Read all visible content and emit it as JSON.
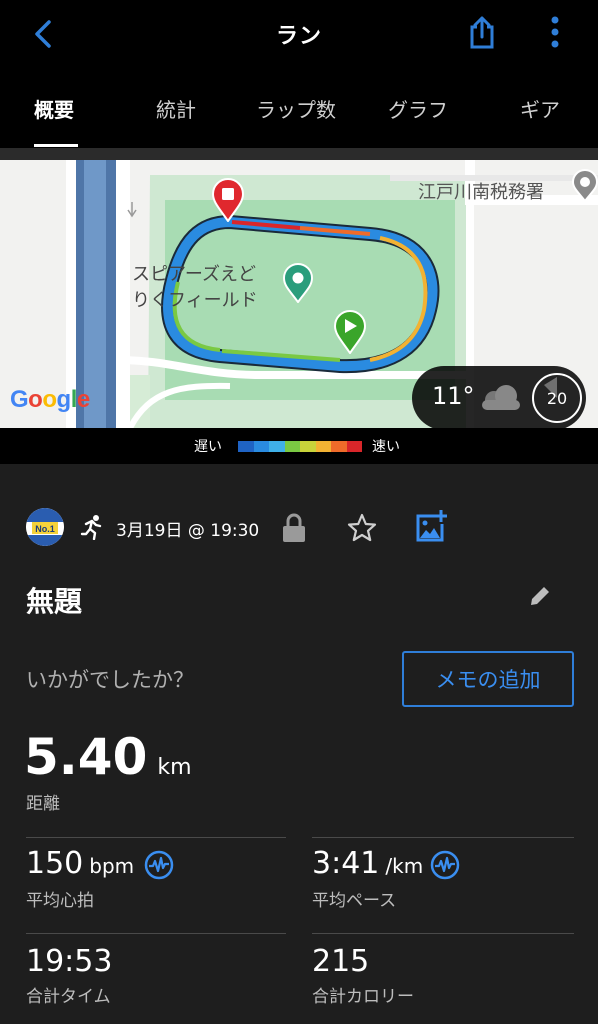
{
  "header": {
    "title": "ラン",
    "back_icon": "chevron-left-icon",
    "share_icon": "share-icon",
    "more_icon": "more-vertical-icon",
    "accent_color": "#2f7ed8"
  },
  "tabs": [
    {
      "label": "概要",
      "active": true
    },
    {
      "label": "統計",
      "active": false
    },
    {
      "label": "ラップ数",
      "active": false
    },
    {
      "label": "グラフ",
      "active": false
    },
    {
      "label": "ギア",
      "active": false
    }
  ],
  "map": {
    "labels": {
      "place_line1": "スピアーズえど",
      "place_line2": "りくフィールド",
      "tax_office": "江戸川南税務署"
    },
    "google_logo": "Google",
    "weather": {
      "temp": "11°",
      "icon": "cloud-icon",
      "wind": "20"
    }
  },
  "legend": {
    "slow": "遅い",
    "fast": "速い",
    "colors": [
      "#1f63c4",
      "#2a8be0",
      "#3fb0e8",
      "#7ac943",
      "#c8d33a",
      "#f2b233",
      "#ef6b2a",
      "#d9262a"
    ]
  },
  "activity": {
    "date": "3月19日 @ 19:30",
    "name": "無題",
    "question": "いかがでしたか？",
    "memo_button": "メモの追加",
    "distance": {
      "value": "5.40",
      "unit": "km",
      "label": "距離"
    },
    "stats": [
      {
        "value": "150",
        "unit": "bpm",
        "label": "平均心拍",
        "icon": "heart-rate-icon"
      },
      {
        "value": "3:41",
        "unit": "/km",
        "label": "平均ペース",
        "icon": "heart-rate-icon"
      },
      {
        "value": "19:53",
        "unit": "",
        "label": "合計タイム"
      },
      {
        "value": "215",
        "unit": "",
        "label": "合計カロリー"
      }
    ]
  }
}
